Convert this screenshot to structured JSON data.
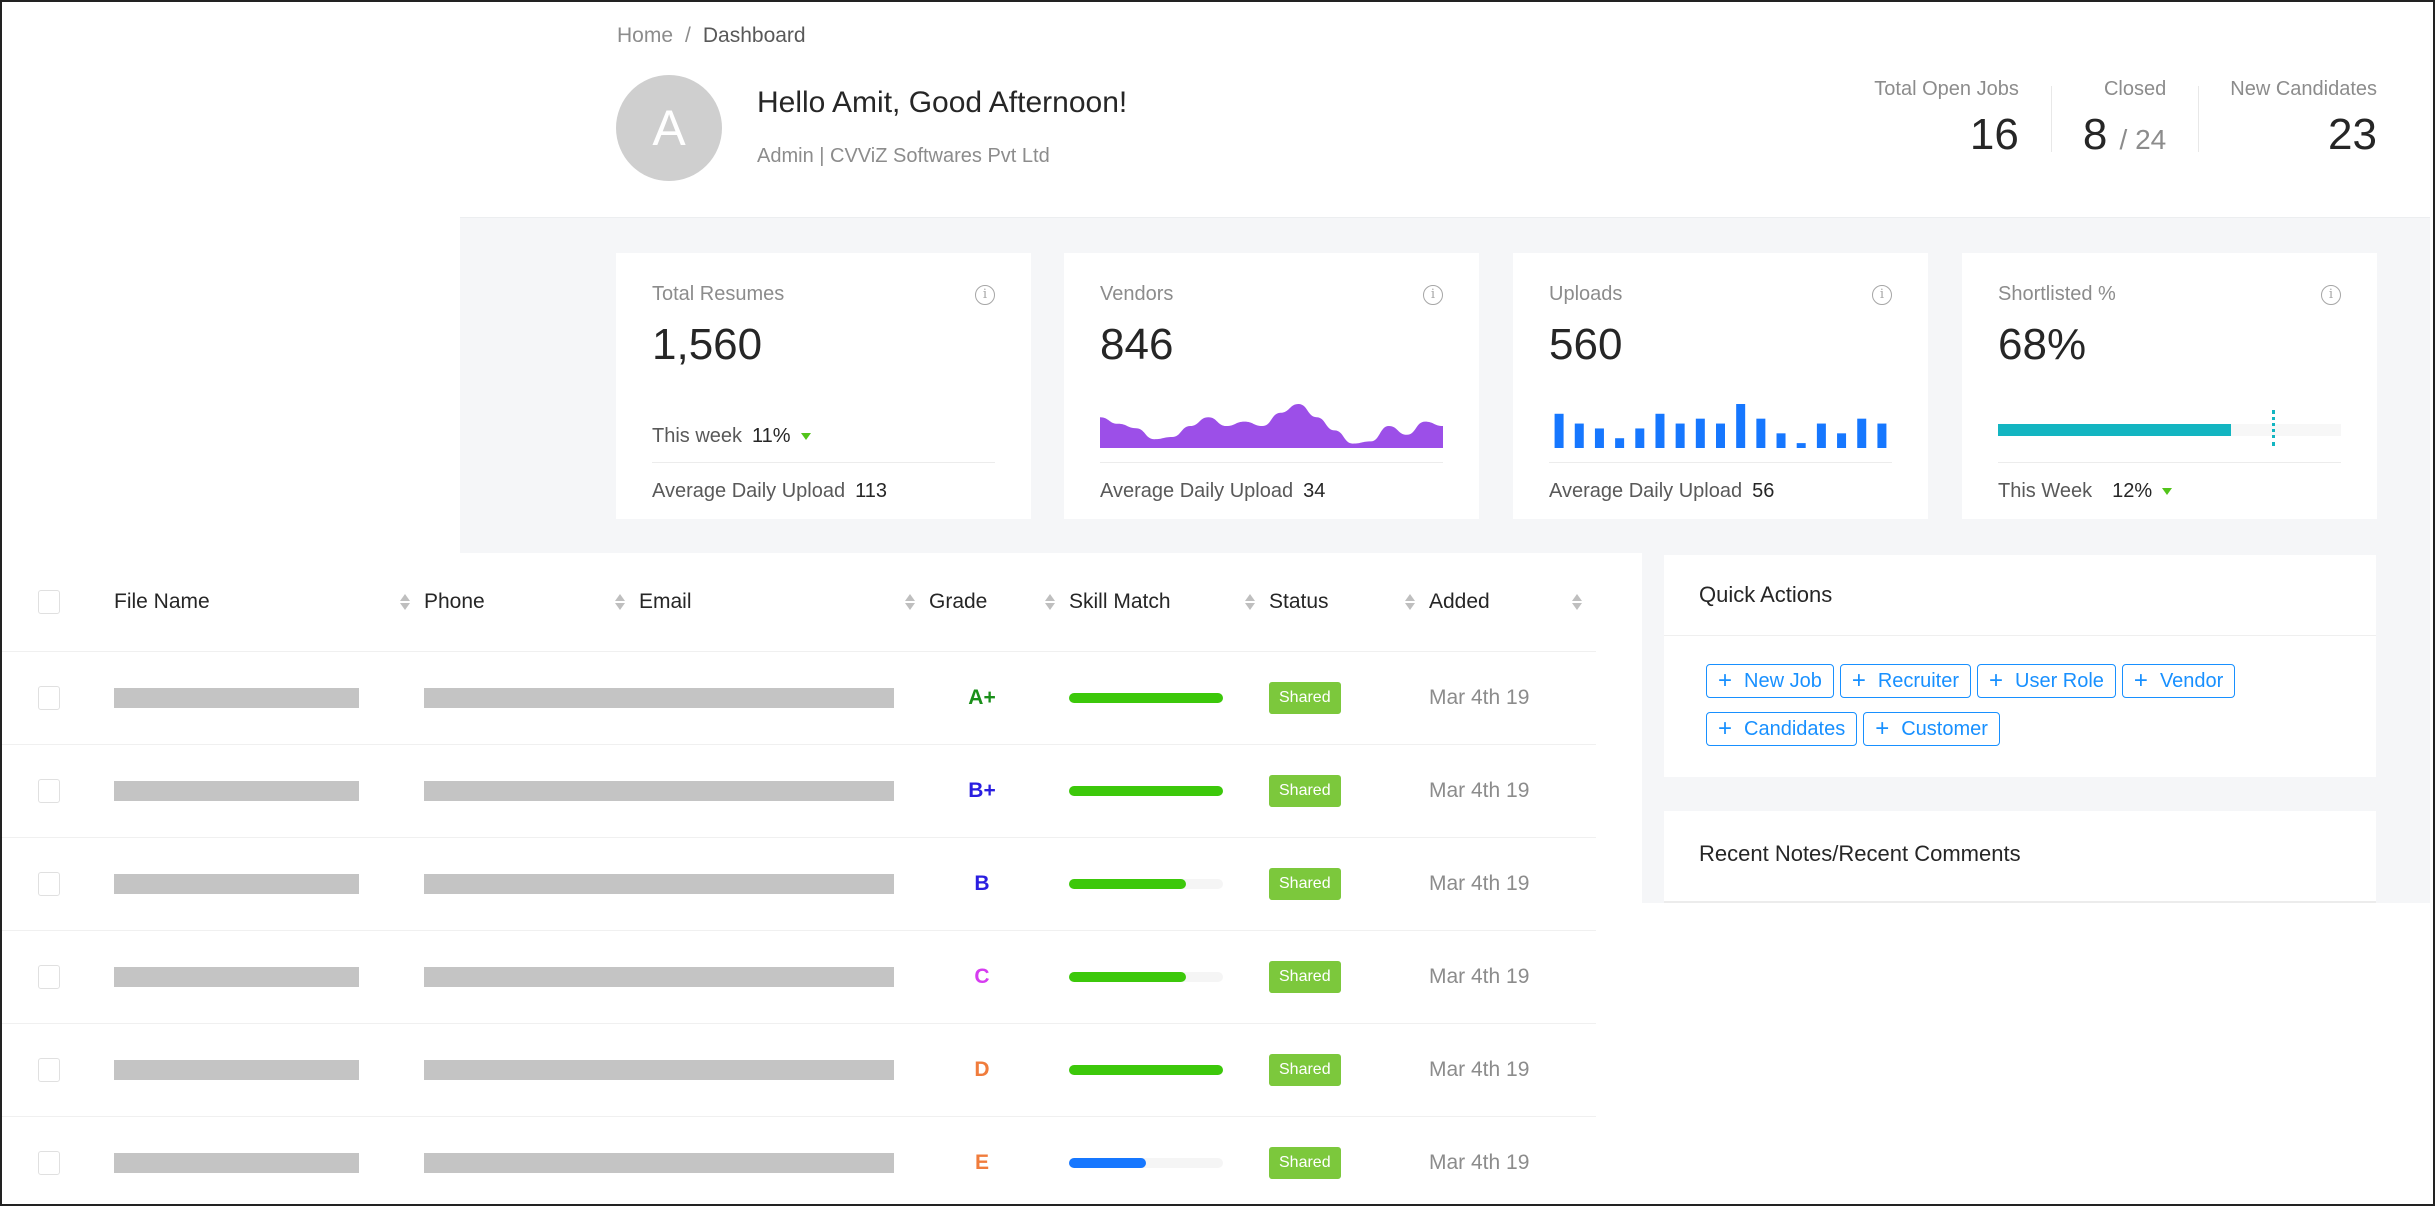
{
  "breadcrumb": {
    "home": "Home",
    "separator": "/",
    "current": "Dashboard"
  },
  "user": {
    "avatar_initial": "A",
    "greeting": "Hello Amit,  Good Afternoon!",
    "subtitle": "Admin | CVViZ Softwares Pvt Ltd"
  },
  "header_stats": [
    {
      "label": "Total Open Jobs",
      "value": "16"
    },
    {
      "label": "Closed",
      "value": "8",
      "suffix": "/ 24"
    },
    {
      "label": "New Candidates",
      "value": "23"
    }
  ],
  "kpis": {
    "total_resumes": {
      "label": "Total Resumes",
      "value": "1,560",
      "trend_label": "This week",
      "trend_value": "11%",
      "trend_direction": "down",
      "footer_label": "Average Daily Upload",
      "footer_value": "113"
    },
    "vendors": {
      "label": "Vendors",
      "value": "846",
      "sparkline": [
        7,
        5.5,
        4.5,
        2,
        2.5,
        5,
        7,
        5,
        6,
        5,
        8,
        10,
        7,
        4,
        1,
        1.5,
        5,
        3,
        6,
        5
      ],
      "color": "#9c4fe8",
      "footer_label": "Average Daily Upload",
      "footer_value": "34"
    },
    "uploads": {
      "label": "Uploads",
      "value": "560",
      "bars": [
        7,
        5,
        4,
        2,
        4,
        7,
        5,
        6,
        5,
        9,
        6,
        3,
        1,
        5,
        3,
        6,
        5
      ],
      "color": "#1677ff",
      "footer_label": "Average Daily Upload",
      "footer_value": "56"
    },
    "shortlisted": {
      "label": "Shortlisted %",
      "value": "68%",
      "progress": 0.68,
      "target": 0.8,
      "color": "#13b5c1",
      "trend_label": "This Week",
      "trend_value": "12%",
      "trend_direction": "down"
    }
  },
  "table": {
    "columns": [
      "File Name",
      "Phone",
      "Email",
      "Grade",
      "Skill Match",
      "Status",
      "Added"
    ],
    "rows": [
      {
        "grade": "A+",
        "grade_color": "#1a8f1a",
        "skill_match": 1.0,
        "skill_color": "#3cc80a",
        "status": "Shared",
        "added": "Mar 4th 19"
      },
      {
        "grade": "B+",
        "grade_color": "#2a1ee0",
        "skill_match": 1.0,
        "skill_color": "#3cc80a",
        "status": "Shared",
        "added": "Mar 4th 19"
      },
      {
        "grade": "B",
        "grade_color": "#2a1ee0",
        "skill_match": 0.76,
        "skill_color": "#3cc80a",
        "status": "Shared",
        "added": "Mar 4th 19"
      },
      {
        "grade": "C",
        "grade_color": "#d63cf0",
        "skill_match": 0.76,
        "skill_color": "#3cc80a",
        "status": "Shared",
        "added": "Mar 4th 19"
      },
      {
        "grade": "D",
        "grade_color": "#f07c3c",
        "skill_match": 1.0,
        "skill_color": "#3cc80a",
        "status": "Shared",
        "added": "Mar 4th 19"
      },
      {
        "grade": "E",
        "grade_color": "#f07c3c",
        "skill_match": 0.5,
        "skill_color": "#1677ff",
        "status": "Shared",
        "added": "Mar 4th 19"
      }
    ]
  },
  "quick_actions": {
    "title": "Quick Actions",
    "buttons": [
      "New Job",
      "Recruiter",
      "User Role",
      "Vendor",
      "Candidates",
      "Customer"
    ]
  },
  "recent_notes": {
    "title": "Recent Notes/Recent Comments"
  }
}
